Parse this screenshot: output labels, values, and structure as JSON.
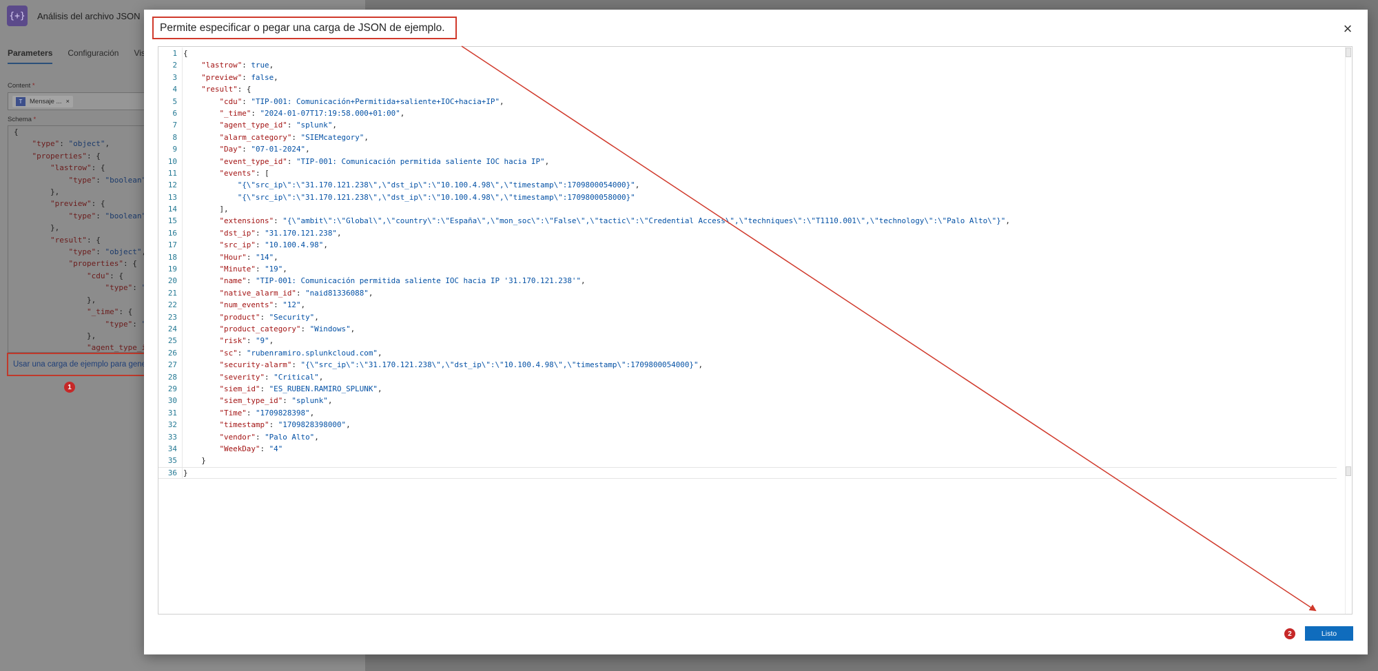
{
  "background": {
    "app_title": "Análisis del archivo JSON",
    "app_icon_glyph": "{+}",
    "tabs": [
      {
        "label": "Parameters",
        "active": true
      },
      {
        "label": "Configuración",
        "active": false
      },
      {
        "label": "Vis",
        "active": false
      }
    ],
    "content_label": "Content",
    "content_token": "Mensaje ...",
    "schema_label": "Schema",
    "required_mark": "*",
    "sample_link": "Usar una carga de ejemplo para generar el esquema",
    "badge_1": "1"
  },
  "modal": {
    "title": "Permite especificar o pegar una carga de JSON de ejemplo.",
    "close_icon": "×",
    "done_button": "Listo",
    "badge_2": "2"
  },
  "schema_preview": [
    "{",
    "    \"type\": \"object\",",
    "    \"properties\": {",
    "        \"lastrow\": {",
    "            \"type\": \"boolean\"",
    "        },",
    "        \"preview\": {",
    "            \"type\": \"boolean\"",
    "        },",
    "        \"result\": {",
    "            \"type\": \"object\",",
    "            \"properties\": {",
    "                \"cdu\": {",
    "                    \"type\": \"string\"",
    "                },",
    "                \"_time\": {",
    "                    \"type\": \"string\"",
    "                },",
    "                \"agent_type_id\": {"
  ],
  "editor_lines": [
    "{",
    "    \"lastrow\": true,",
    "    \"preview\": false,",
    "    \"result\": {",
    "        \"cdu\": \"TIP-001: Comunicación+Permitida+saliente+IOC+hacia+IP\",",
    "        \"_time\": \"2024-01-07T17:19:58.000+01:00\",",
    "        \"agent_type_id\": \"splunk\",",
    "        \"alarm_category\": \"SIEMcategory\",",
    "        \"Day\": \"07-01-2024\",",
    "        \"event_type_id\": \"TIP-001: Comunicación permitida saliente IOC hacia IP\",",
    "        \"events\": [",
    "            \"{\\\"src_ip\\\":\\\"31.170.121.238\\\",\\\"dst_ip\\\":\\\"10.100.4.98\\\",\\\"timestamp\\\":1709800054000}\",",
    "            \"{\\\"src_ip\\\":\\\"31.170.121.238\\\",\\\"dst_ip\\\":\\\"10.100.4.98\\\",\\\"timestamp\\\":1709800058000}\"",
    "        ],",
    "        \"extensions\": \"{\\\"ambit\\\":\\\"Global\\\",\\\"country\\\":\\\"España\\\",\\\"mon_soc\\\":\\\"False\\\",\\\"tactic\\\":\\\"Credential Access\\\",\\\"techniques\\\":\\\"T1110.001\\\",\\\"technology\\\":\\\"Palo Alto\\\"}\",",
    "        \"dst_ip\": \"31.170.121.238\",",
    "        \"src_ip\": \"10.100.4.98\",",
    "        \"Hour\": \"14\",",
    "        \"Minute\": \"19\",",
    "        \"name\": \"TIP-001: Comunicación permitida saliente IOC hacia IP '31.170.121.238'\",",
    "        \"native_alarm_id\": \"naid81336088\",",
    "        \"num_events\": \"12\",",
    "        \"product\": \"Security\",",
    "        \"product_category\": \"Windows\",",
    "        \"risk\": \"9\",",
    "        \"sc\": \"rubenramiro.splunkcloud.com\",",
    "        \"security-alarm\": \"{\\\"src_ip\\\":\\\"31.170.121.238\\\",\\\"dst_ip\\\":\\\"10.100.4.98\\\",\\\"timestamp\\\":1709800054000}\",",
    "        \"severity\": \"Critical\",",
    "        \"siem_id\": \"ES_RUBEN.RAMIRO_SPLUNK\",",
    "        \"siem_type_id\": \"splunk\",",
    "        \"Time\": \"1709828398\",",
    "        \"timestamp\": \"1709828398000\",",
    "        \"vendor\": \"Palo Alto\",",
    "        \"WeekDay\": \"4\"",
    "    }",
    "}"
  ],
  "colors": {
    "annotation_red": "#d0392b",
    "primary_button": "#0f6cbd",
    "json_key": "#a31515",
    "json_value": "#0451a5",
    "line_number": "#237893"
  }
}
